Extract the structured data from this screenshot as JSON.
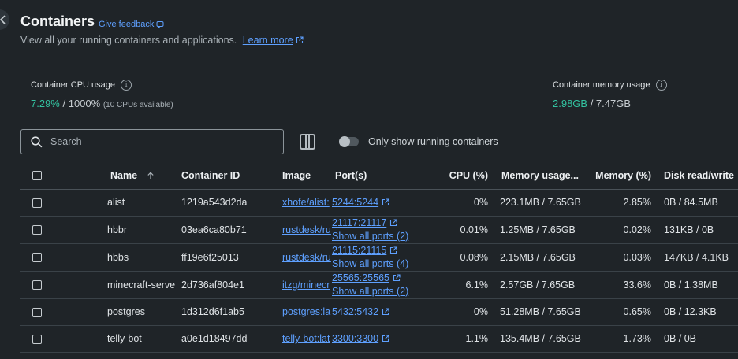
{
  "header": {
    "title": "Containers",
    "feedback_label": "Give feedback",
    "subtitle": "View all your running containers and applications.",
    "learn_more_label": "Learn more"
  },
  "stats": {
    "cpu": {
      "label": "Container CPU usage",
      "value": "7.29%",
      "total": " / 1000%",
      "note": "(10 CPUs available)"
    },
    "memory": {
      "label": "Container memory usage",
      "value": "2.98GB",
      "total": " / 7.47GB"
    }
  },
  "search": {
    "placeholder": "Search",
    "value": ""
  },
  "filter": {
    "toggle_label": "Only show running containers",
    "enabled": false
  },
  "colors": {
    "accent": "#33c2a0",
    "running": "#27b58e",
    "link": "#5ea0ff"
  },
  "table": {
    "headers": {
      "name": "Name",
      "id": "Container ID",
      "image": "Image",
      "ports": "Port(s)",
      "cpu": "CPU (%)",
      "mem_usage": "Memory usage...",
      "mem_pct": "Memory (%)",
      "disk": "Disk read/write"
    },
    "sort_icon": "arrow-up-icon",
    "rows": [
      {
        "name": "alist",
        "id": "1219a543d2da",
        "image": "xhofe/alist:",
        "port": "5244:5244",
        "show_all": "",
        "cpu": "0%",
        "mem_usage": "223.1MB / 7.65GB",
        "mem_pct": "2.85%",
        "disk": "0B / 84.5MB"
      },
      {
        "name": "hbbr",
        "id": "03ea6ca80b71",
        "image": "rustdesk/ru",
        "port": "21117:21117",
        "show_all": "Show all ports (2)",
        "cpu": "0.01%",
        "mem_usage": "1.25MB / 7.65GB",
        "mem_pct": "0.02%",
        "disk": "131KB / 0B"
      },
      {
        "name": "hbbs",
        "id": "ff19e6f25013",
        "image": "rustdesk/ru",
        "port": "21115:21115",
        "show_all": "Show all ports (4)",
        "cpu": "0.08%",
        "mem_usage": "2.15MB / 7.65GB",
        "mem_pct": "0.03%",
        "disk": "147KB / 4.1KB"
      },
      {
        "name": "minecraft-serve",
        "id": "2d736af804e1",
        "image": "itzg/minecr",
        "port": "25565:25565",
        "show_all": "Show all ports (2)",
        "cpu": "6.1%",
        "mem_usage": "2.57GB / 7.65GB",
        "mem_pct": "33.6%",
        "disk": "0B / 1.38MB"
      },
      {
        "name": "postgres",
        "id": "1d312d6f1ab5",
        "image": "postgres:la",
        "port": "5432:5432",
        "show_all": "",
        "cpu": "0%",
        "mem_usage": "51.28MB / 7.65GB",
        "mem_pct": "0.65%",
        "disk": "0B / 12.3KB"
      },
      {
        "name": "telly-bot",
        "id": "a0e1d18497dd",
        "image": "telly-bot:lat",
        "port": "3300:3300",
        "show_all": "",
        "cpu": "1.1%",
        "mem_usage": "135.4MB / 7.65GB",
        "mem_pct": "1.73%",
        "disk": "0B / 0B"
      }
    ]
  }
}
